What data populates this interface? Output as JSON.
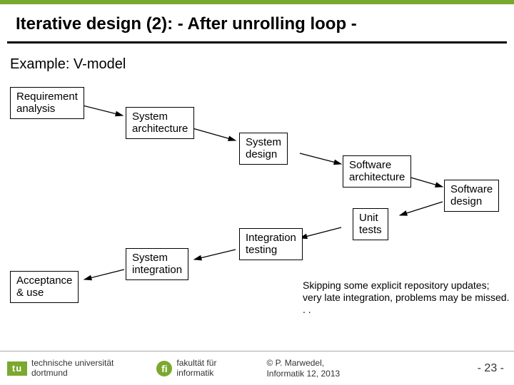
{
  "header": {
    "title": "Iterative design (2): - After unrolling loop -",
    "subtitle": "Example: V-model"
  },
  "boxes": {
    "req": "Requirement\nanalysis",
    "sysarch": "System\narchitecture",
    "sysdes": "System\ndesign",
    "swarch": "Software\narchitecture",
    "swdes": "Software\ndesign",
    "unit": "Unit\ntests",
    "integ": "Integration\ntesting",
    "sysint": "System\nintegration",
    "accept": "Acceptance\n& use"
  },
  "note": "Skipping some explicit repository updates;\nvery late integration, problems may be missed. . .",
  "footer": {
    "tu": "technische universität\ndortmund",
    "fi": "fakultät für\ninformatik",
    "copyright": "©  P. Marwedel,\nInformatik 12,   2013",
    "page": "-   23 -"
  }
}
